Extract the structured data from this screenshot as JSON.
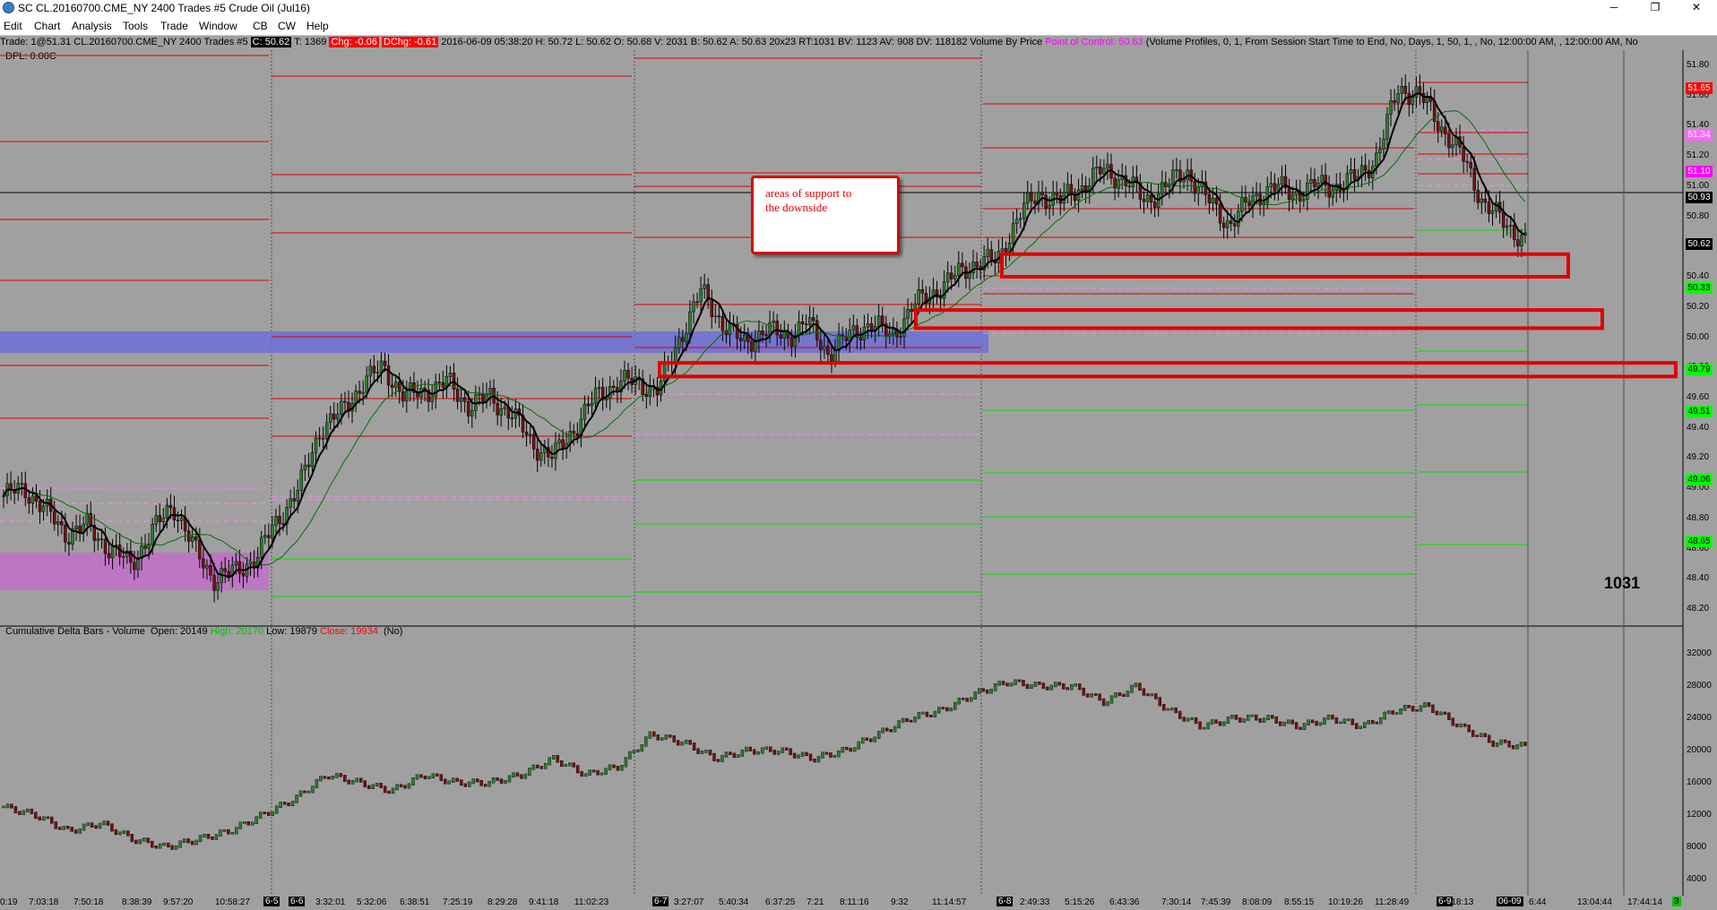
{
  "window": {
    "title": "SC CL.20160700.CME_NY  2400 Trades  #5  Crude Oil (Jul16)",
    "minimize": "─",
    "restore": "❐",
    "close": "✕"
  },
  "menu": [
    "Edit",
    "Chart",
    "Analysis",
    "Tools",
    "Trade",
    "Window",
    "CB",
    "CW",
    "Help"
  ],
  "infobar": {
    "trade": "Trade: 1@51.31  CL.20160700.CME_NY  2400 Trades  #5",
    "c_tag": "C: 50.62",
    "t": "T: 1369",
    "chg": "Chg: -0.06",
    "dchg": "DChg: -0.61",
    "stats": "2016-06-09 05:38:20  H: 50.72  L: 50.62  O: 50.68  V: 2031  B: 50.62  A: 50.63  20x23  RT:1031  BV: 1123  AV: 908  DV: 118182  Volume By Price",
    "poc": "Point of Control: 50.63",
    "profile": "(Volume Profiles, 0, 1, From Session Start Time to End, No, Days, 1, 50, 1, , No, 12:00:00 AM, , 12:00:00 AM, No"
  },
  "dpl": "DPL: 0.00C",
  "annotation": {
    "line1": "areas of support to",
    "line2": "the downside"
  },
  "bar_counter": "1031",
  "lower_study": {
    "name": "Cumulative Delta Bars - Volume",
    "open": "Open: 20149",
    "high": "High: 20170",
    "low": "Low: 19879",
    "close": "Close: 19934",
    "flag": "(No)"
  },
  "price_axis": [
    "51.80",
    "51.60",
    "51.40",
    "51.20",
    "51.00",
    "50.80",
    "50.60",
    "50.40",
    "50.20",
    "50.00",
    "49.80",
    "49.60",
    "49.40",
    "49.20",
    "49.00",
    "48.80",
    "48.60",
    "48.40",
    "48.20"
  ],
  "price_tags": [
    {
      "text": "51.65",
      "bg": "#ff0000",
      "fg": "#ffffff"
    },
    {
      "text": "51.34",
      "bg": "#ff66ff",
      "fg": "#ffffff"
    },
    {
      "text": "51.10",
      "bg": "#ff00ff",
      "fg": "#ffffff"
    },
    {
      "text": "50.93",
      "bg": "#000000",
      "fg": "#ffffff"
    },
    {
      "text": "50.62",
      "bg": "#000000",
      "fg": "#ffffff"
    },
    {
      "text": "50.33",
      "bg": "#00ff00",
      "fg": "#000000"
    },
    {
      "text": "49.79",
      "bg": "#00ff00",
      "fg": "#000000"
    },
    {
      "text": "49.51",
      "bg": "#00ff00",
      "fg": "#000000"
    },
    {
      "text": "49.06",
      "bg": "#00ff00",
      "fg": "#000000"
    },
    {
      "text": "48.65",
      "bg": "#00ff00",
      "fg": "#000000"
    }
  ],
  "delta_axis": [
    "32000",
    "28000",
    "24000",
    "20000",
    "16000",
    "12000",
    "8000",
    "4000"
  ],
  "time_labels": [
    "0:19",
    "7:03:18",
    "7:50:18",
    "8:38:39",
    "9:57:20",
    "10:58:27",
    "3:32:01",
    "5:32:06",
    "6:38:51",
    "7:25:19",
    "8:29:28",
    "9:41:18",
    "11:02:23",
    "3:27:07",
    "5:40:34",
    "6:37:25",
    "7:21",
    "8:11:16",
    "9:32",
    "11:14:57",
    "2:49:33",
    "5:15:26",
    "6:43:36",
    "7:30:14",
    "7:45:39",
    "8:08:09",
    "8:55:15",
    "10:19:26",
    "11:28:49",
    "2:18:13",
    "05:33",
    "6:44",
    "13:04:44",
    "17:44:14"
  ],
  "date_tags": [
    "6-5",
    "6-6",
    "6-7",
    "6-8",
    "6-9",
    "06-09"
  ],
  "corner_tag": "3",
  "colors": {
    "background": "#a0a0a0",
    "resistance": "#e00000",
    "support": "#00e000",
    "value_area": "#6f6fd6",
    "value_area2": "#c270c8",
    "ema": "#000000",
    "vwap": "#007000"
  },
  "chart_data": {
    "type": "candlestick",
    "title": "CL.20160700.CME_NY 2400 Trades #5 Crude Oil (Jul16)",
    "ylim": [
      48.1,
      51.9
    ],
    "price_path": [
      48.95,
      49.0,
      48.85,
      48.7,
      48.75,
      48.6,
      48.5,
      48.7,
      48.9,
      48.6,
      48.4,
      48.45,
      48.55,
      48.8,
      49.0,
      49.4,
      49.5,
      49.7,
      49.8,
      49.6,
      49.65,
      49.7,
      49.55,
      49.6,
      49.5,
      49.3,
      49.2,
      49.4,
      49.6,
      49.7,
      49.7,
      49.65,
      50.0,
      50.3,
      50.1,
      49.95,
      50.05,
      50.0,
      50.1,
      49.9,
      50.0,
      50.1,
      50.0,
      50.2,
      50.3,
      50.4,
      50.5,
      50.5,
      50.8,
      50.95,
      50.9,
      51.0,
      51.1,
      51.05,
      50.9,
      51.0,
      51.1,
      50.9,
      50.75,
      50.9,
      51.0,
      50.95,
      51.0,
      51.0,
      51.05,
      51.2,
      51.65,
      51.6,
      51.4,
      51.2,
      50.9,
      50.75,
      50.65
    ],
    "support_zones": [
      [
        50.4,
        50.55
      ],
      [
        50.06,
        50.18
      ],
      [
        49.74,
        49.83
      ]
    ],
    "delta_ylim": [
      2000,
      34000
    ],
    "delta_path": [
      13000,
      12000,
      10000,
      11000,
      9000,
      8000,
      9000,
      10000,
      12000,
      14000,
      17000,
      16000,
      15000,
      17000,
      16000,
      16000,
      17000,
      19000,
      17000,
      18000,
      22000,
      21000,
      19000,
      20000,
      20000,
      19000,
      20000,
      22000,
      24000,
      25000,
      27000,
      28500,
      28000,
      28000,
      26000,
      28000,
      25000,
      23000,
      24000,
      24000,
      23000,
      24000,
      23000,
      25000,
      25500,
      23000,
      21000,
      20500
    ]
  }
}
